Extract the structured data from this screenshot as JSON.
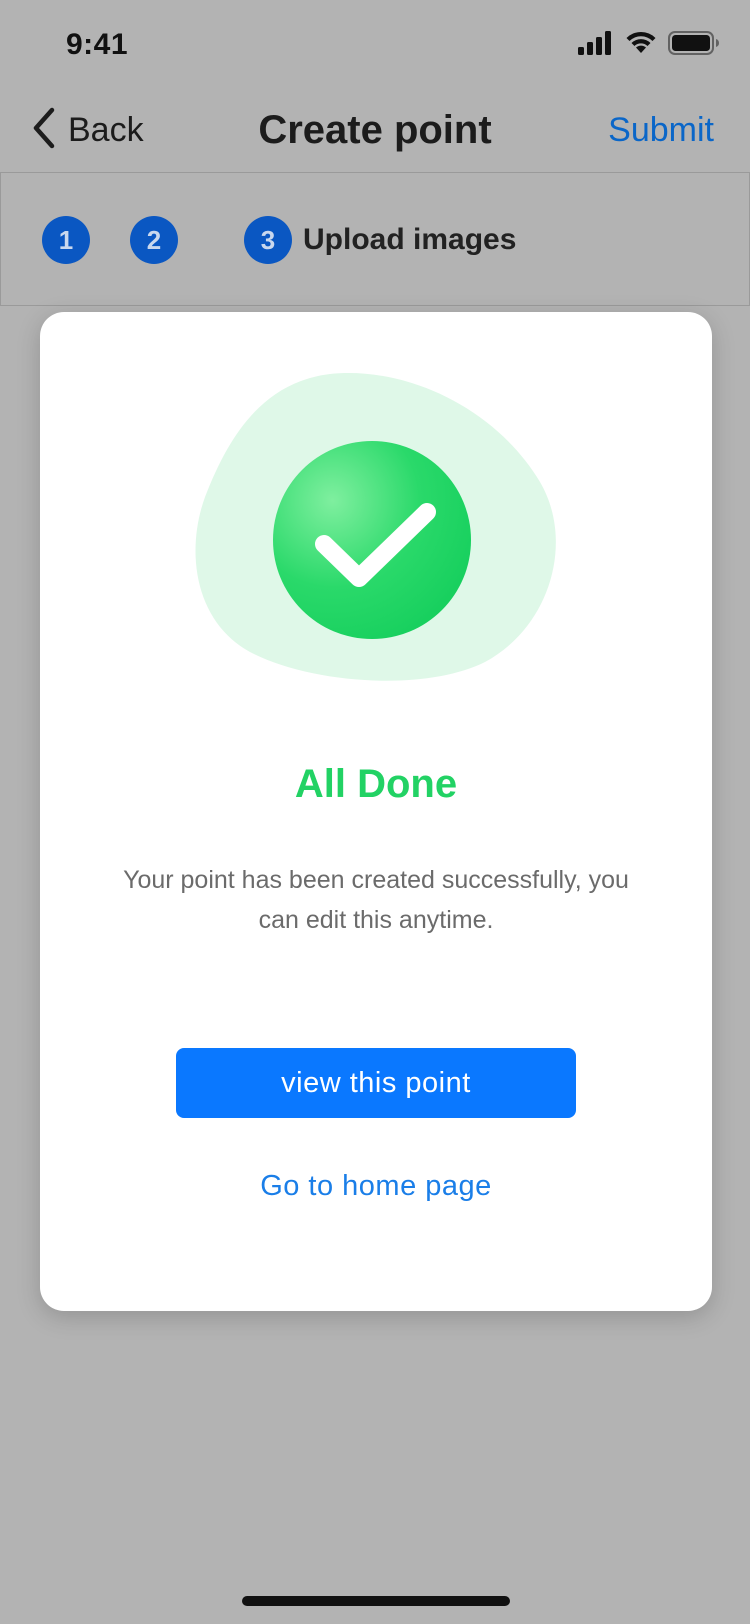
{
  "status_bar": {
    "time": "9:41",
    "icons": [
      "cellular-signal-icon",
      "wifi-icon",
      "battery-icon"
    ]
  },
  "nav": {
    "back_label": "Back",
    "back_icon": "chevron-left-icon",
    "title": "Create point",
    "submit_label": "Submit"
  },
  "stepper": {
    "steps": [
      {
        "number": "1"
      },
      {
        "number": "2"
      },
      {
        "number": "3",
        "label": "Upload images"
      }
    ],
    "active_step": 3
  },
  "modal": {
    "icon": "checkmark-success-icon",
    "title": "All Done",
    "message": "Your point has been created successfully, you can edit this anytime.",
    "primary_button": "view this point",
    "secondary_link": "Go to home page"
  },
  "colors": {
    "overlay_background": "#b3b3b3",
    "accent_blue": "#0a78ff",
    "step_blue": "#0a57c2",
    "success_green": "#22d264",
    "success_blob": "#dff8e8"
  }
}
